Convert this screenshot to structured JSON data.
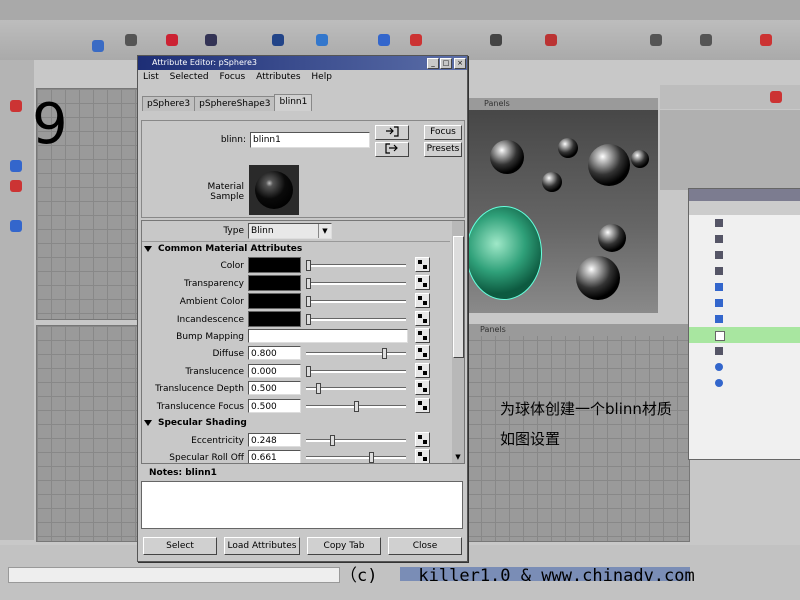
{
  "window": {
    "title": "Attribute Editor: pSphere3",
    "menu": [
      "List",
      "Selected",
      "Focus",
      "Attributes",
      "Help"
    ],
    "tabs": [
      "pSphere3",
      "pSphereShape3",
      "blinn1"
    ]
  },
  "node": {
    "label": "blinn:",
    "name": "blinn1",
    "focus_label": "Focus",
    "presets_label": "Presets",
    "material_sample_label": "Material Sample",
    "type_label": "Type",
    "type_value": "Blinn"
  },
  "common_section": {
    "title": "Common Material Attributes",
    "color_label": "Color",
    "transparency_label": "Transparency",
    "ambient_label": "Ambient Color",
    "incandescence_label": "Incandescence",
    "bump_label": "Bump Mapping",
    "diffuse_label": "Diffuse",
    "diffuse_value": "0.800",
    "translucence_label": "Translucence",
    "translucence_value": "0.000",
    "tdepth_label": "Translucence Depth",
    "tdepth_value": "0.500",
    "tfocus_label": "Translucence Focus",
    "tfocus_value": "0.500"
  },
  "specular_section": {
    "title": "Specular Shading",
    "ecc_label": "Eccentricity",
    "ecc_value": "0.248",
    "rolloff_label": "Specular Roll Off",
    "rolloff_value": "0.661"
  },
  "notes": {
    "label": "Notes: blinn1"
  },
  "buttons": {
    "select": "Select",
    "load": "Load Attributes",
    "copy": "Copy Tab",
    "close": "Close"
  },
  "sliders": {
    "color": 0.0,
    "transparency": 0.0,
    "ambient": 0.0,
    "incandescence": 0.0,
    "diffuse": 0.8,
    "translucence": 0.0,
    "tdepth": 0.1,
    "tfocus": 0.5,
    "ecc": 0.248,
    "rolloff": 0.661
  },
  "overlay": {
    "step_number": "9",
    "line1": "为球体创建一个blinn材质",
    "line2": "如图设置",
    "credit": "（c)    killer1.0 & www.chinadv.com"
  },
  "viewport": {
    "header_menu": "Panels"
  }
}
